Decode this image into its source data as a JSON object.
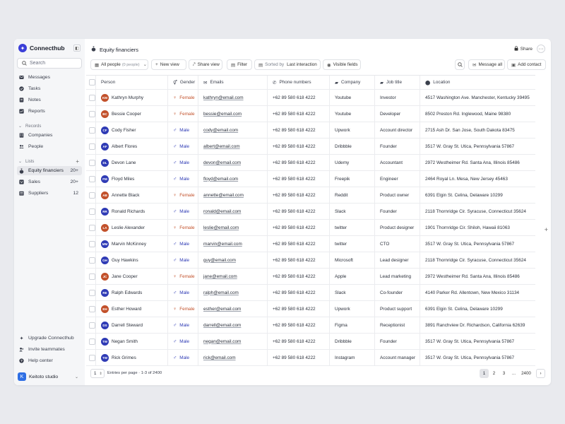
{
  "brand": {
    "name": "Connecthub"
  },
  "search": {
    "placeholder": "Search"
  },
  "nav": {
    "main": [
      {
        "label": "Messages",
        "icon": "message-icon"
      },
      {
        "label": "Tasks",
        "icon": "check-circle-icon"
      },
      {
        "label": "Notes",
        "icon": "note-icon"
      },
      {
        "label": "Reports",
        "icon": "chart-icon"
      }
    ],
    "records_title": "Records",
    "records": [
      {
        "label": "Companies",
        "icon": "building-icon"
      },
      {
        "label": "People",
        "icon": "people-icon"
      }
    ],
    "lists_title": "Lists",
    "lists": [
      {
        "label": "Equity financiers",
        "count": "20+"
      },
      {
        "label": "Sales",
        "count": "20+"
      },
      {
        "label": "Suppliers",
        "count": "12"
      }
    ],
    "bottom": [
      {
        "label": "Upgrade Connecthub"
      },
      {
        "label": "Invite teammates"
      },
      {
        "label": "Help center"
      }
    ]
  },
  "workspace": {
    "name": "Keitoto studio",
    "logo": "K"
  },
  "page": {
    "title": "Equity financiers",
    "share": "Share"
  },
  "toolbar": {
    "view": "All people",
    "view_count": "(0 people)",
    "new_view": "New view",
    "share_view": "Share view",
    "filter": "Filter",
    "sorted_by": "Sorted by",
    "sort_field": "Last interaction",
    "visible_fields": "Visible fields",
    "message_all": "Message all",
    "add_contact": "Add contact"
  },
  "columns": {
    "person": "Person",
    "gender": "Gender",
    "emails": "Emails",
    "phone": "Phone numbers",
    "company": "Company",
    "job": "Job title",
    "location": "Location"
  },
  "rows": [
    {
      "initials": "KM",
      "color": "#c2502a",
      "name": "Kathryn Murphy",
      "gender": "Female",
      "email": "kathryn@email.com",
      "phone": "+62 89 580 618 4222",
      "company": "Youtube",
      "job": "Investor",
      "location": "4517 Washington Ave. Manchester, Kentucky 39495"
    },
    {
      "initials": "BC",
      "color": "#c2502a",
      "name": "Bessie Cooper",
      "gender": "Female",
      "email": "bessie@email.com",
      "phone": "+62 89 580 618 4222",
      "company": "Youtube",
      "job": "Developer",
      "location": "8502 Preston Rd. Inglewood, Maine 98380"
    },
    {
      "initials": "CF",
      "color": "#2f3bb5",
      "name": "Cody Fisher",
      "gender": "Male",
      "email": "cody@email.com",
      "phone": "+62 89 580 618 4222",
      "company": "Upwork",
      "job": "Account director",
      "location": "2715 Ash Dr. San Jose, South Dakota 83475"
    },
    {
      "initials": "AF",
      "color": "#2f3bb5",
      "name": "Albert Flores",
      "gender": "Male",
      "email": "albert@email.com",
      "phone": "+62 89 580 618 4222",
      "company": "Dribbble",
      "job": "Founder",
      "location": "3517 W. Gray St. Utica, Pennsylvania 57867"
    },
    {
      "initials": "DL",
      "color": "#2f3bb5",
      "name": "Devon Lane",
      "gender": "Male",
      "email": "devon@email.com",
      "phone": "+62 89 580 618 4222",
      "company": "Udemy",
      "job": "Accountant",
      "location": "2972 Westheimer Rd. Santa Ana, Illinois 85486"
    },
    {
      "initials": "FM",
      "color": "#2f3bb5",
      "name": "Floyd Miles",
      "gender": "Male",
      "email": "floyd@email.com",
      "phone": "+62 89 580 618 4222",
      "company": "Freepik",
      "job": "Engineer",
      "location": "2464 Royal Ln. Mesa, New Jersey 45463"
    },
    {
      "initials": "AB",
      "color": "#c2502a",
      "name": "Annette Black",
      "gender": "Female",
      "email": "annette@email.com",
      "phone": "+62 89 580 618 4222",
      "company": "Reddit",
      "job": "Product owner",
      "location": "6391 Elgin St. Celina, Delaware 10299"
    },
    {
      "initials": "RR",
      "color": "#2f3bb5",
      "name": "Ronald Richards",
      "gender": "Male",
      "email": "ronald@email.com",
      "phone": "+62 89 580 618 4222",
      "company": "Slack",
      "job": "Founder",
      "location": "2118 Thornridge Cir. Syracuse, Connecticut 35624"
    },
    {
      "initials": "LA",
      "color": "#c2502a",
      "name": "Leslie Alexander",
      "gender": "Female",
      "email": "leslie@email.com",
      "phone": "+62 89 580 618 4222",
      "company": "twitter",
      "job": "Product designer",
      "location": "1901 Thornridge Cir. Shiloh, Hawaii 81063"
    },
    {
      "initials": "MM",
      "color": "#2f3bb5",
      "name": "Marvin McKinney",
      "gender": "Male",
      "email": "marvin@email.com",
      "phone": "+62 89 580 618 4222",
      "company": "twitter",
      "job": "CTO",
      "location": "3517 W. Gray St. Utica, Pennsylvania 57867"
    },
    {
      "initials": "GH",
      "color": "#2f3bb5",
      "name": "Guy Hawkins",
      "gender": "Male",
      "email": "guy@email.com",
      "phone": "+62 89 580 618 4222",
      "company": "Microsoft",
      "job": "Lead designer",
      "location": "2118 Thornridge Cir. Syracuse, Connecticut 35624"
    },
    {
      "initials": "JC",
      "color": "#c2502a",
      "name": "Jane Cooper",
      "gender": "Female",
      "email": "jane@email.com",
      "phone": "+62 89 580 618 4222",
      "company": "Apple",
      "job": "Lead marketing",
      "location": "2972 Westheimer Rd. Santa Ana, Illinois 85486"
    },
    {
      "initials": "RE",
      "color": "#2f3bb5",
      "name": "Ralph Edwards",
      "gender": "Male",
      "email": "ralph@email.com",
      "phone": "+62 89 580 618 4222",
      "company": "Slack",
      "job": "Co-founder",
      "location": "4140 Parker Rd. Allentown, New Mexico 31134"
    },
    {
      "initials": "EH",
      "color": "#c2502a",
      "name": "Esther Howard",
      "gender": "Female",
      "email": "esther@email.com",
      "phone": "+62 89 580 618 4222",
      "company": "Upwork",
      "job": "Product support",
      "location": "6391 Elgin St. Celina, Delaware 10299"
    },
    {
      "initials": "DS",
      "color": "#2f3bb5",
      "name": "Darrell Steward",
      "gender": "Male",
      "email": "darrell@email.com",
      "phone": "+62 89 580 618 4222",
      "company": "Figma",
      "job": "Receptionist",
      "location": "3891 Ranchview Dr. Richardson, California 62639"
    },
    {
      "initials": "TW",
      "color": "#2f3bb5",
      "name": "Negan Smith",
      "gender": "Male",
      "email": "negan@email.com",
      "phone": "+62 89 580 618 4222",
      "company": "Dribbble",
      "job": "Founder",
      "location": "3517 W. Gray St. Utica, Pennsylvania 57867"
    },
    {
      "initials": "TW",
      "color": "#2f3bb5",
      "name": "Rick Grimes",
      "gender": "Male",
      "email": "rick@email.com",
      "phone": "+62 89 580 618 4222",
      "company": "Instagram",
      "job": "Account manager",
      "location": "3517 W. Gray St. Utica, Pennsylvania 57867"
    }
  ],
  "gender_colors": {
    "Female": "#c2502a",
    "Male": "#2f3bb5"
  },
  "footer": {
    "per_page": "1",
    "entries_label": "Entries per page",
    "range": "1-3 of 2400",
    "pages": [
      "1",
      "2",
      "3",
      "...",
      "2400"
    ],
    "next": "›"
  }
}
